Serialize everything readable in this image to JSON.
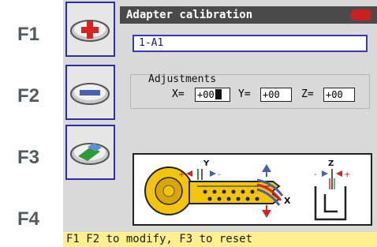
{
  "function_keys": {
    "f1": "F1",
    "f2": "F2",
    "f3": "F3",
    "f4": "F4"
  },
  "title": "Adapter calibration",
  "adapter_field": {
    "value": "1-A1"
  },
  "adjustments": {
    "label": "Adjustments",
    "x": {
      "label": "X=",
      "value": "+00"
    },
    "y": {
      "label": "Y=",
      "value": "+00"
    },
    "z": {
      "label": "Z=",
      "value": "+00"
    }
  },
  "status_text": "F1 F2 to modify, F3 to reset",
  "icons": {
    "f1": "plus-icon",
    "f2": "minus-icon",
    "f3": "eraser-icon",
    "logo": "brand-logo-icon"
  },
  "colors": {
    "screen_bg": "#d9d9d9",
    "title_bg": "#4a4a4a",
    "status_bg": "#ffef8e",
    "accent_red": "#cc1f1f",
    "key_yellow": "#f2c40a",
    "frame_blue": "#2d2da8"
  }
}
